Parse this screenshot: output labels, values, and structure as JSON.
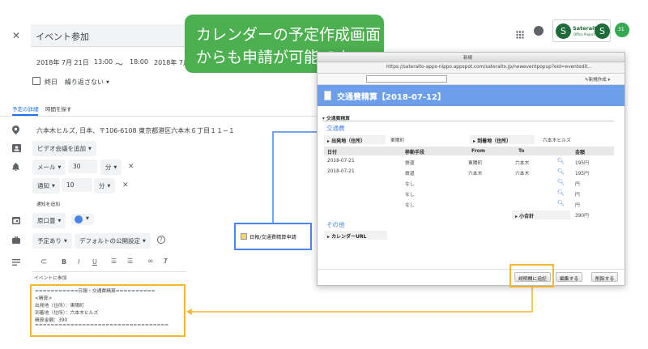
{
  "event": {
    "title": "イベント参加",
    "start_date": "2018年 7月 21日",
    "start_time": "13:00",
    "tilde": "〜",
    "end_time": "18:00",
    "end_date": "2018年 7月",
    "allday_label": "終日",
    "repeat": "繰り返さない"
  },
  "tabs": {
    "details": "予定の詳細",
    "find_time": "時間を探す"
  },
  "location": "六本木ヒルズ, 日本、〒106-6108 東京都港区六本木６丁目１１−１",
  "video": "ビデオ会議を追加",
  "notifications": [
    {
      "type": "メール",
      "value": "30",
      "unit": "分"
    },
    {
      "type": "通知",
      "value": "10",
      "unit": "分"
    }
  ],
  "add_notification": "通知を追加",
  "calendar_name": "原口豊",
  "calendar_color": "#4a86e8",
  "busy": "予定あり",
  "visibility": "デフォルトの公開設定",
  "description_lines": [
    "イベントに参加",
    "===========日報・交通費精算==========",
    "<精算>",
    "出発地（住所）：東陽町",
    "到着地（住所）：六本木ヒルズ",
    "精算金額：390",
    "=================================="
  ],
  "callout": {
    "line1": "カレンダーの予定作成画面",
    "line2": "からも申請が可能です。",
    "color": "#4caf50"
  },
  "addon_label": "日報/交通費精算申請",
  "sateraito": {
    "brand": "Sateraito",
    "sub": "Office Project"
  },
  "calendar_badge": "31",
  "popup": {
    "window_title": "新規",
    "url": "https://sateraito-apps-nippo.appspot.com/sateraito.jp/neweventpopup?eid=eventedit...",
    "new_button": "新規作成",
    "header_title": "交通費精算【2018-07-12】",
    "section": "交通費精算",
    "subsection_transport": "交通費",
    "departure_label": "出発地（住所）",
    "departure_value": "東陽町",
    "arrival_label": "到着地（住所）",
    "arrival_value": "六本木ヒルズ",
    "columns": [
      "日付",
      "移動手段",
      "From",
      "To",
      "",
      "金額"
    ],
    "rows": [
      {
        "date": "2018-07-21",
        "method": "鉄道",
        "from": "東陽町",
        "to": "六本木",
        "amount": "195円"
      },
      {
        "date": "2018-07-21",
        "method": "鉄道",
        "from": "六本木",
        "to": "六本木",
        "amount": "195円"
      },
      {
        "date": "",
        "method": "なし",
        "from": "",
        "to": "",
        "amount": "円"
      },
      {
        "date": "",
        "method": "なし",
        "from": "",
        "to": "",
        "amount": "円"
      },
      {
        "date": "",
        "method": "なし",
        "from": "",
        "to": "",
        "amount": "円"
      }
    ],
    "subtotal_label": "小合計",
    "subtotal_value": "390円",
    "other_label": "その他",
    "calendar_url_label": "カレンダーURL",
    "buttons": {
      "append": "説明欄に追記",
      "edit": "編集する",
      "delete": "削除する"
    }
  },
  "highlight_color": "#f5b731",
  "arrow_color": "#4a86e8"
}
